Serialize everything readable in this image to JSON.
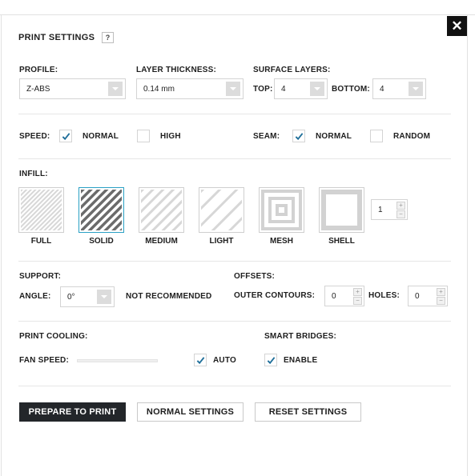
{
  "header": {
    "title": "PRINT SETTINGS",
    "help_label": "?",
    "close_label": "✕"
  },
  "profile": {
    "label": "PROFILE:",
    "value": "Z-ABS"
  },
  "layer_thickness": {
    "label": "LAYER THICKNESS:",
    "value": "0.14 mm"
  },
  "surface_layers": {
    "label": "SURFACE LAYERS:",
    "top_label": "TOP:",
    "top_value": "4",
    "bottom_label": "BOTTOM:",
    "bottom_value": "4"
  },
  "speed": {
    "label": "SPEED:",
    "normal_label": "NORMAL",
    "normal_checked": true,
    "high_label": "HIGH",
    "high_checked": false
  },
  "seam": {
    "label": "SEAM:",
    "normal_label": "NORMAL",
    "normal_checked": true,
    "random_label": "RANDOM",
    "random_checked": false
  },
  "infill": {
    "label": "INFILL:",
    "options": [
      {
        "label": "FULL",
        "selected": false
      },
      {
        "label": "SOLID",
        "selected": true
      },
      {
        "label": "MEDIUM",
        "selected": false
      },
      {
        "label": "LIGHT",
        "selected": false
      },
      {
        "label": "MESH",
        "selected": false
      },
      {
        "label": "SHELL",
        "selected": false
      }
    ],
    "count_value": "1"
  },
  "support": {
    "label": "SUPPORT:",
    "angle_label": "ANGLE:",
    "angle_value": "0°",
    "note": "NOT RECOMMENDED"
  },
  "offsets": {
    "label": "OFFSETS:",
    "outer_label": "OUTER CONTOURS:",
    "outer_value": "0",
    "holes_label": "HOLES:",
    "holes_value": "0"
  },
  "cooling": {
    "label": "PRINT COOLING:",
    "fan_label": "FAN SPEED:",
    "auto_label": "AUTO",
    "auto_checked": true
  },
  "bridges": {
    "label": "SMART BRIDGES:",
    "enable_label": "ENABLE",
    "enable_checked": true
  },
  "buttons": {
    "prepare": "PREPARE TO PRINT",
    "normal": "NORMAL SETTINGS",
    "reset": "RESET SETTINGS"
  },
  "colors": {
    "accent": "#2aa0c4",
    "check": "#1f6f9a",
    "primary_button": "#23262a"
  }
}
